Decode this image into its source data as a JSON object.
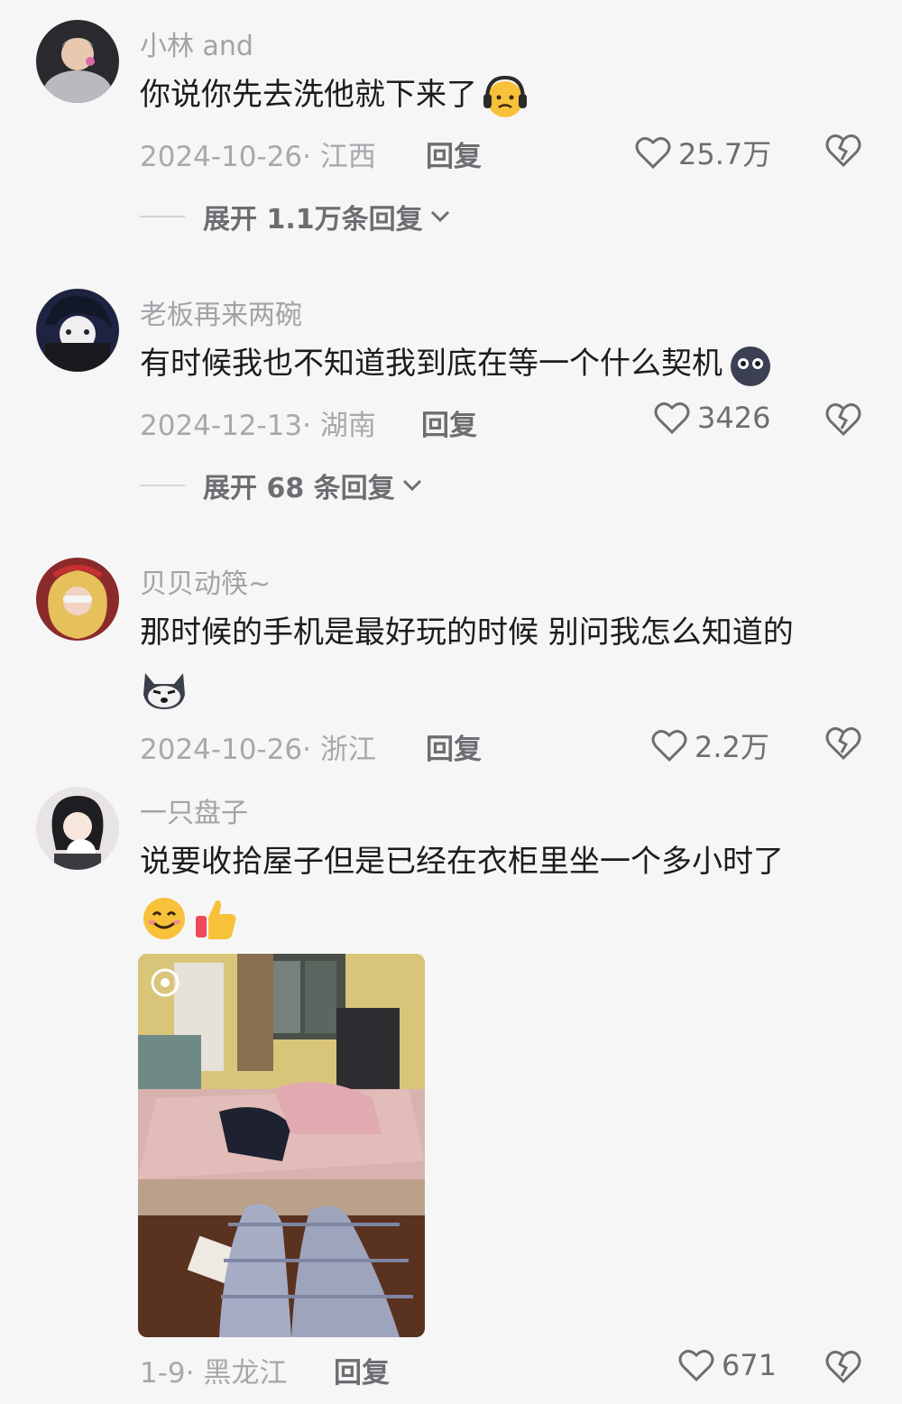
{
  "comments": [
    {
      "username": "小林 and",
      "text": "你说你先去洗他就下来了",
      "emoji": [
        "headphones-face-emoji"
      ],
      "meta": "2024-10-26· 江西",
      "reply": "回复",
      "likes": "25.7万",
      "expand": "展开 1.1万条回复"
    },
    {
      "username": "老板再来两碗",
      "text": "有时候我也不知道我到底在等一个什么契机",
      "emoji": [
        "dark-face-emoji"
      ],
      "meta": "2024-12-13· 湖南",
      "reply": "回复",
      "likes": "3426",
      "expand": "展开 68 条回复"
    },
    {
      "username": "贝贝动筷~",
      "text": "那时候的手机是最好玩的时候 别问我怎么知道的",
      "emoji": [
        "husky-emoji"
      ],
      "meta": "2024-10-26· 浙江",
      "reply": "回复",
      "likes": "2.2万"
    },
    {
      "username": "一只盘子",
      "text": "说要收拾屋子但是已经在衣柜里坐一个多小时了",
      "emoji": [
        "smile-emoji",
        "thumbs-up-emoji"
      ],
      "meta": "1-9· 黑龙江",
      "reply": "回复",
      "likes": "671",
      "photo": "bedroom-photo"
    }
  ],
  "colors": {
    "background": "#f6f6f6",
    "text": "#1c1c1e",
    "muted": "#a8a8ad",
    "action": "#6d6d72"
  }
}
